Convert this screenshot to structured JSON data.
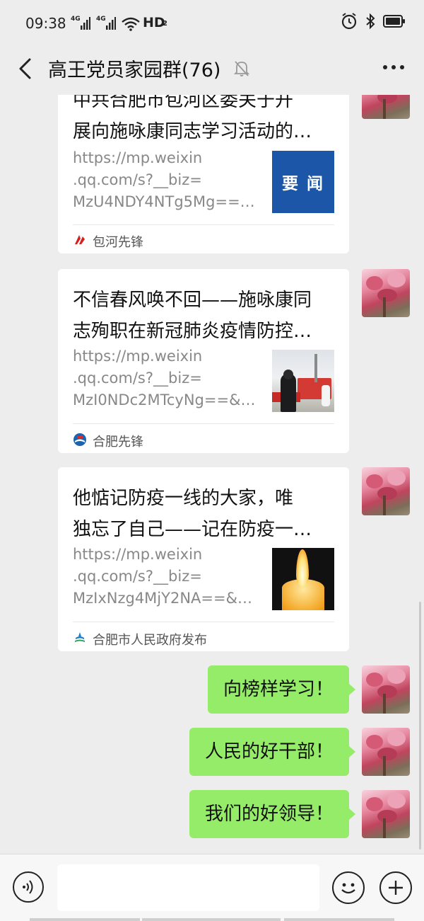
{
  "status_bar": {
    "time": "09:38",
    "signal_1": "4G",
    "signal_2": "4G",
    "network": "HD",
    "network_sub": "2",
    "icons": [
      "signal-icon",
      "wifi-icon",
      "alarm-icon",
      "bluetooth-icon",
      "battery-icon"
    ]
  },
  "header": {
    "title": "高王党员家园群(76)",
    "icons": [
      "back-icon",
      "mute-bell-icon",
      "more-icon"
    ]
  },
  "messages": [
    {
      "type": "article",
      "title_lines": [
        "中共合肥市包河区委关于开",
        "展向施咏康同志学习活动的…"
      ],
      "link_lines": [
        "https://mp.weixin",
        ".qq.com/s?__biz=",
        "MzU4NDY4NTg5Mg==…"
      ],
      "thumb_text": "要 闻",
      "source": "包河先锋"
    },
    {
      "type": "article",
      "title_lines": [
        "不信春风唤不回——施咏康同",
        "志殉职在新冠肺炎疫情防控…"
      ],
      "link_lines": [
        "https://mp.weixin",
        ".qq.com/s?__biz=",
        "MzI0NDc2MTcyNg==&…"
      ],
      "source": "合肥先锋"
    },
    {
      "type": "article",
      "title_lines": [
        "他惦记防疫一线的大家，唯",
        "独忘了自己——记在防疫一…"
      ],
      "link_lines": [
        "https://mp.weixin",
        ".qq.com/s?__biz=",
        "MzIxNzg4MjY2NA==&…"
      ],
      "source": "合肥市人民政府发布"
    },
    {
      "type": "text",
      "text": "向榜样学习！"
    },
    {
      "type": "text",
      "text": "人民的好干部！"
    },
    {
      "type": "text",
      "text": "我们的好领导！"
    }
  ],
  "input_bar": {
    "message_value": "",
    "icons": [
      "voice-icon",
      "emoji-icon",
      "plus-icon"
    ]
  },
  "colors": {
    "background": "#ededed",
    "sent_bubble": "#95ec69",
    "card": "#ffffff",
    "thumb_blue": "#1b56a8"
  }
}
